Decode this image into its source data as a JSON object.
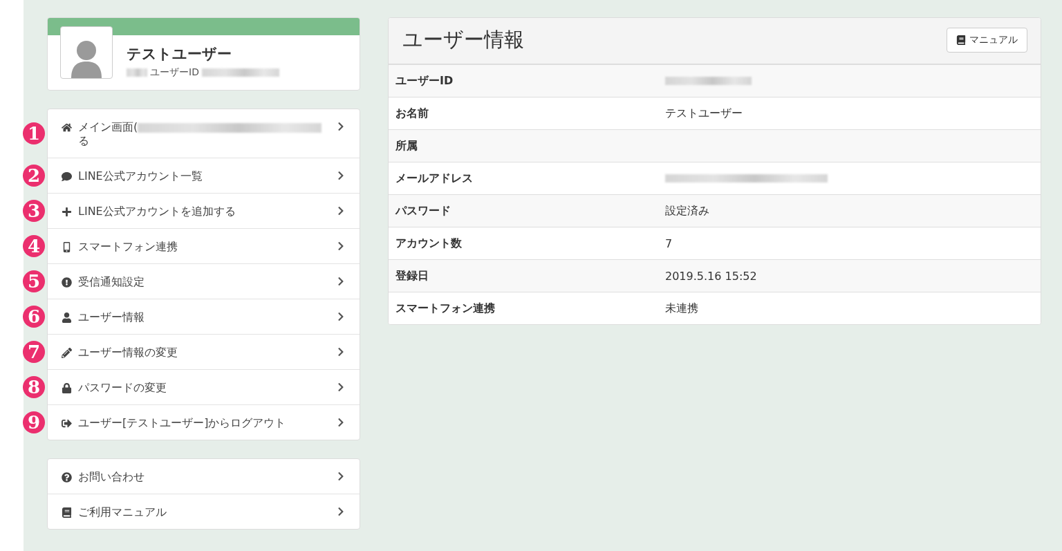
{
  "profile": {
    "name": "テストユーザー",
    "id_label": "ユーザーID",
    "id_redacted": true
  },
  "menu": [
    {
      "badge": "1",
      "kind": "home",
      "label": "メイン画面(",
      "redacted": true,
      "label_end": "る"
    },
    {
      "badge": "2",
      "kind": "comment",
      "label": "LINE公式アカウント一覧"
    },
    {
      "badge": "3",
      "kind": "plus",
      "label": "LINE公式アカウントを追加する"
    },
    {
      "badge": "4",
      "kind": "mobile",
      "label": "スマートフォン連携"
    },
    {
      "badge": "5",
      "kind": "alert",
      "label": "受信通知設定"
    },
    {
      "badge": "6",
      "kind": "user",
      "label": "ユーザー情報"
    },
    {
      "badge": "7",
      "kind": "pencil",
      "label": "ユーザー情報の変更"
    },
    {
      "badge": "8",
      "kind": "lock",
      "label": "パスワードの変更"
    },
    {
      "badge": "9",
      "kind": "logout",
      "label": "ユーザー[テストユーザー]からログアウト"
    }
  ],
  "help_menu": [
    {
      "kind": "question",
      "label": "お問い合わせ"
    },
    {
      "kind": "book",
      "label": "ご利用マニュアル"
    }
  ],
  "panel": {
    "title": "ユーザー情報",
    "manual_button": "マニュアル",
    "rows": [
      {
        "kind": "redacted",
        "label": "ユーザーID"
      },
      {
        "kind": "text",
        "label": "お名前",
        "value": "テストユーザー"
      },
      {
        "kind": "empty",
        "label": "所属"
      },
      {
        "kind": "redacted",
        "label": "メールアドレス"
      },
      {
        "kind": "text",
        "label": "パスワード",
        "value": "設定済み"
      },
      {
        "kind": "text",
        "label": "アカウント数",
        "value": "7"
      },
      {
        "kind": "text",
        "label": "登録日",
        "value": "2019.5.16 15:52"
      },
      {
        "kind": "text",
        "label": "スマートフォン連携",
        "value": "未連携"
      }
    ]
  }
}
